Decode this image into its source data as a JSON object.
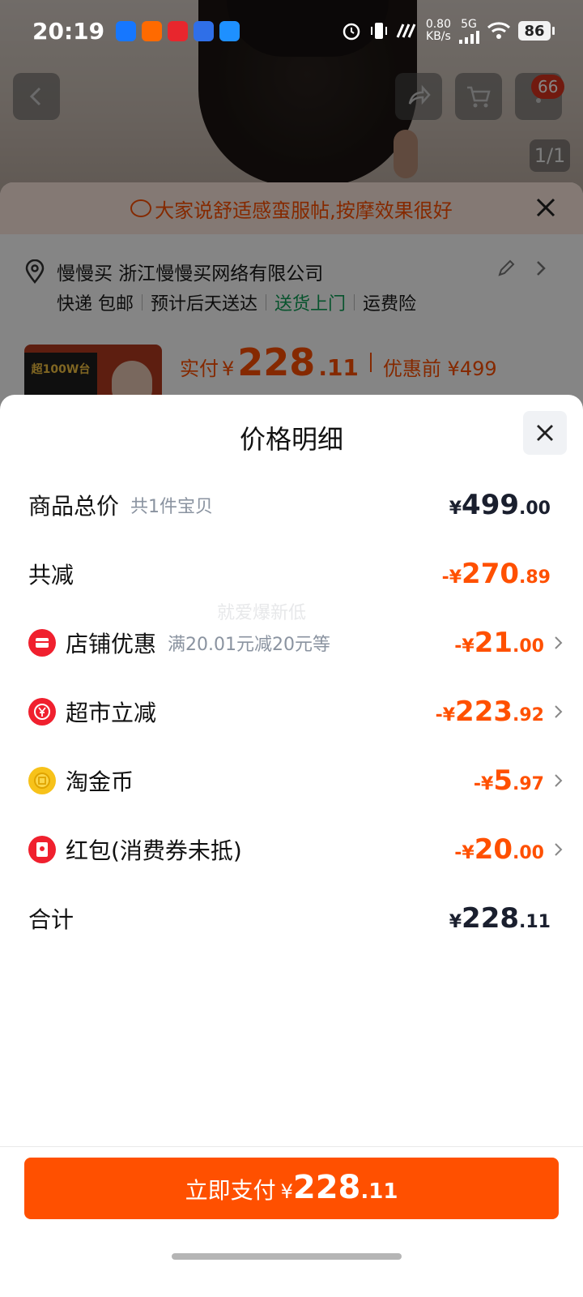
{
  "status_bar": {
    "time": "20:19",
    "net_speed_value": "0.80",
    "net_speed_unit": "KB/s",
    "network_type": "5G",
    "battery": "86"
  },
  "background": {
    "cart_badge": "66",
    "image_index": "1/1",
    "tip_text": "大家说舒适感蛮服帖,按摩效果很好",
    "address": "慢慢买 浙江慢慢买网络有限公司",
    "delivery_tags": [
      "快递 包邮",
      "预计后天送达",
      "送货上门",
      "运费险"
    ],
    "thumb_tag": "超100W台",
    "price_prefix": "实付",
    "price_currency": "¥",
    "price_int": "228",
    "price_dec": ".11",
    "before_discount": "优惠前 ¥499"
  },
  "modal": {
    "title": "价格明细",
    "rows": [
      {
        "label": "商品总价",
        "sub": "共1件宝贝",
        "currency": "¥",
        "int": "499",
        "dec": ".00",
        "color": "dark"
      },
      {
        "label": "共减",
        "sub": "",
        "currency": "-¥",
        "int": "270",
        "dec": ".89",
        "color": "orange"
      },
      {
        "label": "店铺优惠",
        "sub": "满20.01元减20元等",
        "currency": "-¥",
        "int": "21",
        "dec": ".00",
        "color": "orange",
        "icon": "store-coupon-icon"
      },
      {
        "label": "超市立减",
        "sub": "",
        "currency": "-¥",
        "int": "223",
        "dec": ".92",
        "color": "orange",
        "icon": "yuan-coin-icon"
      },
      {
        "label": "淘金币",
        "sub": "",
        "currency": "-¥",
        "int": "5",
        "dec": ".97",
        "color": "orange",
        "icon": "gold-coin-icon"
      },
      {
        "label": "红包(消费券未抵)",
        "sub": "",
        "currency": "-¥",
        "int": "20",
        "dec": ".00",
        "color": "orange",
        "icon": "red-envelope-icon"
      },
      {
        "label": "合计",
        "sub": "",
        "currency": "¥",
        "int": "228",
        "dec": ".11",
        "color": "dark"
      }
    ],
    "watermark": "就爱爆新低",
    "pay_button": {
      "label": "立即支付",
      "currency": "¥",
      "int": "228",
      "dec": ".11"
    }
  },
  "colors": {
    "accent": "#ff5000",
    "dark_amount": "#1a1f2e",
    "green_tag": "#0e9f57"
  }
}
